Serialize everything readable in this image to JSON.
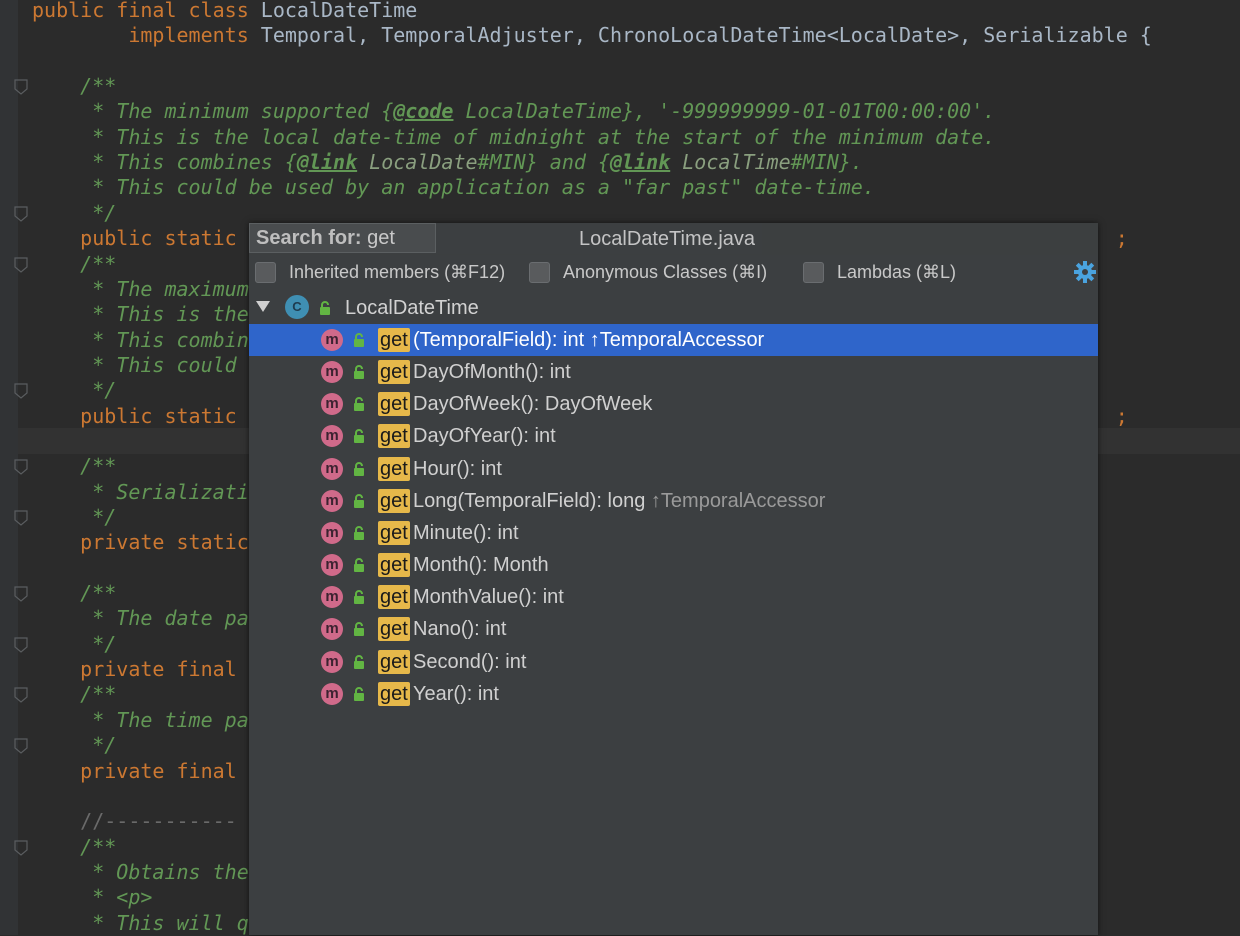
{
  "editor": {
    "lines": [
      {
        "id": "l1",
        "parts": [
          {
            "t": "public final class ",
            "c": "kw"
          },
          {
            "t": "LocalDateTime",
            "c": ""
          }
        ]
      },
      {
        "id": "l2",
        "parts": [
          {
            "t": "        implements ",
            "c": "kw"
          },
          {
            "t": "Temporal, TemporalAdjuster, ChronoLocalDateTime<LocalDate>, Serializable {",
            "c": ""
          }
        ]
      },
      {
        "id": "l3",
        "parts": []
      },
      {
        "id": "l4",
        "parts": [
          {
            "t": "    /**",
            "c": "doc"
          }
        ]
      },
      {
        "id": "l5",
        "parts": [
          {
            "t": "     * The minimum supported {",
            "c": "doc"
          },
          {
            "t": "@code",
            "c": "tag"
          },
          {
            "t": " LocalDateTime}, '-999999999-01-01T00:00:00'.",
            "c": "doc"
          }
        ]
      },
      {
        "id": "l6",
        "parts": [
          {
            "t": "     * This is the local date-time of midnight at the start of the minimum date.",
            "c": "doc"
          }
        ]
      },
      {
        "id": "l7",
        "parts": [
          {
            "t": "     * This combines {",
            "c": "doc"
          },
          {
            "t": "@link",
            "c": "tag"
          },
          {
            "t": " LocalDate",
            "c": "ref"
          },
          {
            "t": "#MIN} and {",
            "c": "doc"
          },
          {
            "t": "@link",
            "c": "tag"
          },
          {
            "t": " LocalTime",
            "c": "ref"
          },
          {
            "t": "#MIN}.",
            "c": "doc"
          }
        ]
      },
      {
        "id": "l8",
        "parts": [
          {
            "t": "     * This could be used by an application as a \"far past\" date-time.",
            "c": "doc"
          }
        ]
      },
      {
        "id": "l9",
        "parts": [
          {
            "t": "     */",
            "c": "doc"
          }
        ]
      },
      {
        "id": "l10",
        "parts": [
          {
            "t": "    public static ",
            "c": "kw"
          },
          {
            "t": "                                                                        ",
            "c": ""
          },
          {
            "t": ";",
            "c": "kw"
          }
        ]
      },
      {
        "id": "l11",
        "parts": [
          {
            "t": "    /**",
            "c": "doc"
          }
        ]
      },
      {
        "id": "l12",
        "parts": [
          {
            "t": "     * The maximum",
            "c": "doc"
          }
        ]
      },
      {
        "id": "l13",
        "parts": [
          {
            "t": "     * This is the",
            "c": "doc"
          }
        ]
      },
      {
        "id": "l14",
        "parts": [
          {
            "t": "     * This combin",
            "c": "doc"
          }
        ]
      },
      {
        "id": "l15",
        "parts": [
          {
            "t": "     * This could ",
            "c": "doc"
          }
        ]
      },
      {
        "id": "l16",
        "parts": [
          {
            "t": "     */",
            "c": "doc"
          }
        ]
      },
      {
        "id": "l17",
        "parts": [
          {
            "t": "    public static ",
            "c": "kw"
          },
          {
            "t": "                                                                        ",
            "c": ""
          },
          {
            "t": ";",
            "c": "kw"
          }
        ]
      },
      {
        "id": "l18",
        "parts": []
      },
      {
        "id": "l19",
        "parts": [
          {
            "t": "    /**",
            "c": "doc"
          }
        ]
      },
      {
        "id": "l20",
        "parts": [
          {
            "t": "     * Serializati",
            "c": "doc"
          }
        ]
      },
      {
        "id": "l21",
        "parts": [
          {
            "t": "     */",
            "c": "doc"
          }
        ]
      },
      {
        "id": "l22",
        "parts": [
          {
            "t": "    private static",
            "c": "kw"
          }
        ]
      },
      {
        "id": "l23",
        "parts": []
      },
      {
        "id": "l24",
        "parts": [
          {
            "t": "    /**",
            "c": "doc"
          }
        ]
      },
      {
        "id": "l25",
        "parts": [
          {
            "t": "     * The date pa",
            "c": "doc"
          }
        ]
      },
      {
        "id": "l26",
        "parts": [
          {
            "t": "     */",
            "c": "doc"
          }
        ]
      },
      {
        "id": "l27",
        "parts": [
          {
            "t": "    private final ",
            "c": "kw"
          }
        ]
      },
      {
        "id": "l28",
        "parts": [
          {
            "t": "    /**",
            "c": "doc"
          }
        ]
      },
      {
        "id": "l29",
        "parts": [
          {
            "t": "     * The time pa",
            "c": "doc"
          }
        ]
      },
      {
        "id": "l30",
        "parts": [
          {
            "t": "     */",
            "c": "doc"
          }
        ]
      },
      {
        "id": "l31",
        "parts": [
          {
            "t": "    private final ",
            "c": "kw"
          }
        ]
      },
      {
        "id": "l32",
        "parts": []
      },
      {
        "id": "l33",
        "parts": [
          {
            "t": "    //-----------",
            "c": "dim"
          }
        ]
      },
      {
        "id": "l34",
        "parts": [
          {
            "t": "    /**",
            "c": "doc"
          }
        ]
      },
      {
        "id": "l35",
        "parts": [
          {
            "t": "     * Obtains the",
            "c": "doc"
          }
        ]
      },
      {
        "id": "l36",
        "parts": [
          {
            "t": "     * <p>",
            "c": "doc"
          }
        ]
      },
      {
        "id": "l37",
        "parts": [
          {
            "t": "     * This will qu",
            "c": "doc"
          }
        ]
      }
    ]
  },
  "popup": {
    "search_prefix": "Search for:",
    "search_value": "get",
    "title": "LocalDateTime.java",
    "options": [
      {
        "label": "Inherited members (⌘F12)"
      },
      {
        "label": "Anonymous Classes (⌘I)"
      },
      {
        "label": "Lambdas (⌘L)"
      }
    ],
    "root_label": "LocalDateTime",
    "class_icon_letter": "C",
    "method_icon_letter": "m",
    "match_text": "get",
    "members": [
      {
        "sig": "(TemporalField): int ",
        "inherited": "↑TemporalAccessor",
        "selected": true
      },
      {
        "sig": "DayOfMonth(): int",
        "inherited": ""
      },
      {
        "sig": "DayOfWeek(): DayOfWeek",
        "inherited": ""
      },
      {
        "sig": "DayOfYear(): int",
        "inherited": ""
      },
      {
        "sig": "Hour(): int",
        "inherited": ""
      },
      {
        "sig": "Long(TemporalField): long ",
        "inherited": "↑TemporalAccessor"
      },
      {
        "sig": "Minute(): int",
        "inherited": ""
      },
      {
        "sig": "Month(): Month",
        "inherited": ""
      },
      {
        "sig": "MonthValue(): int",
        "inherited": ""
      },
      {
        "sig": "Nano(): int",
        "inherited": ""
      },
      {
        "sig": "Second(): int",
        "inherited": ""
      },
      {
        "sig": "Year(): int",
        "inherited": ""
      }
    ]
  },
  "colors": {
    "selection": "#2f65ca",
    "match": "#e6b84a",
    "method_icon": "#d06a8a",
    "keyword": "#cc7832",
    "doc": "#629755"
  },
  "icons": {
    "settings": "gear-icon",
    "expand": "triangle-down-icon",
    "visibility": "lock-icon"
  }
}
